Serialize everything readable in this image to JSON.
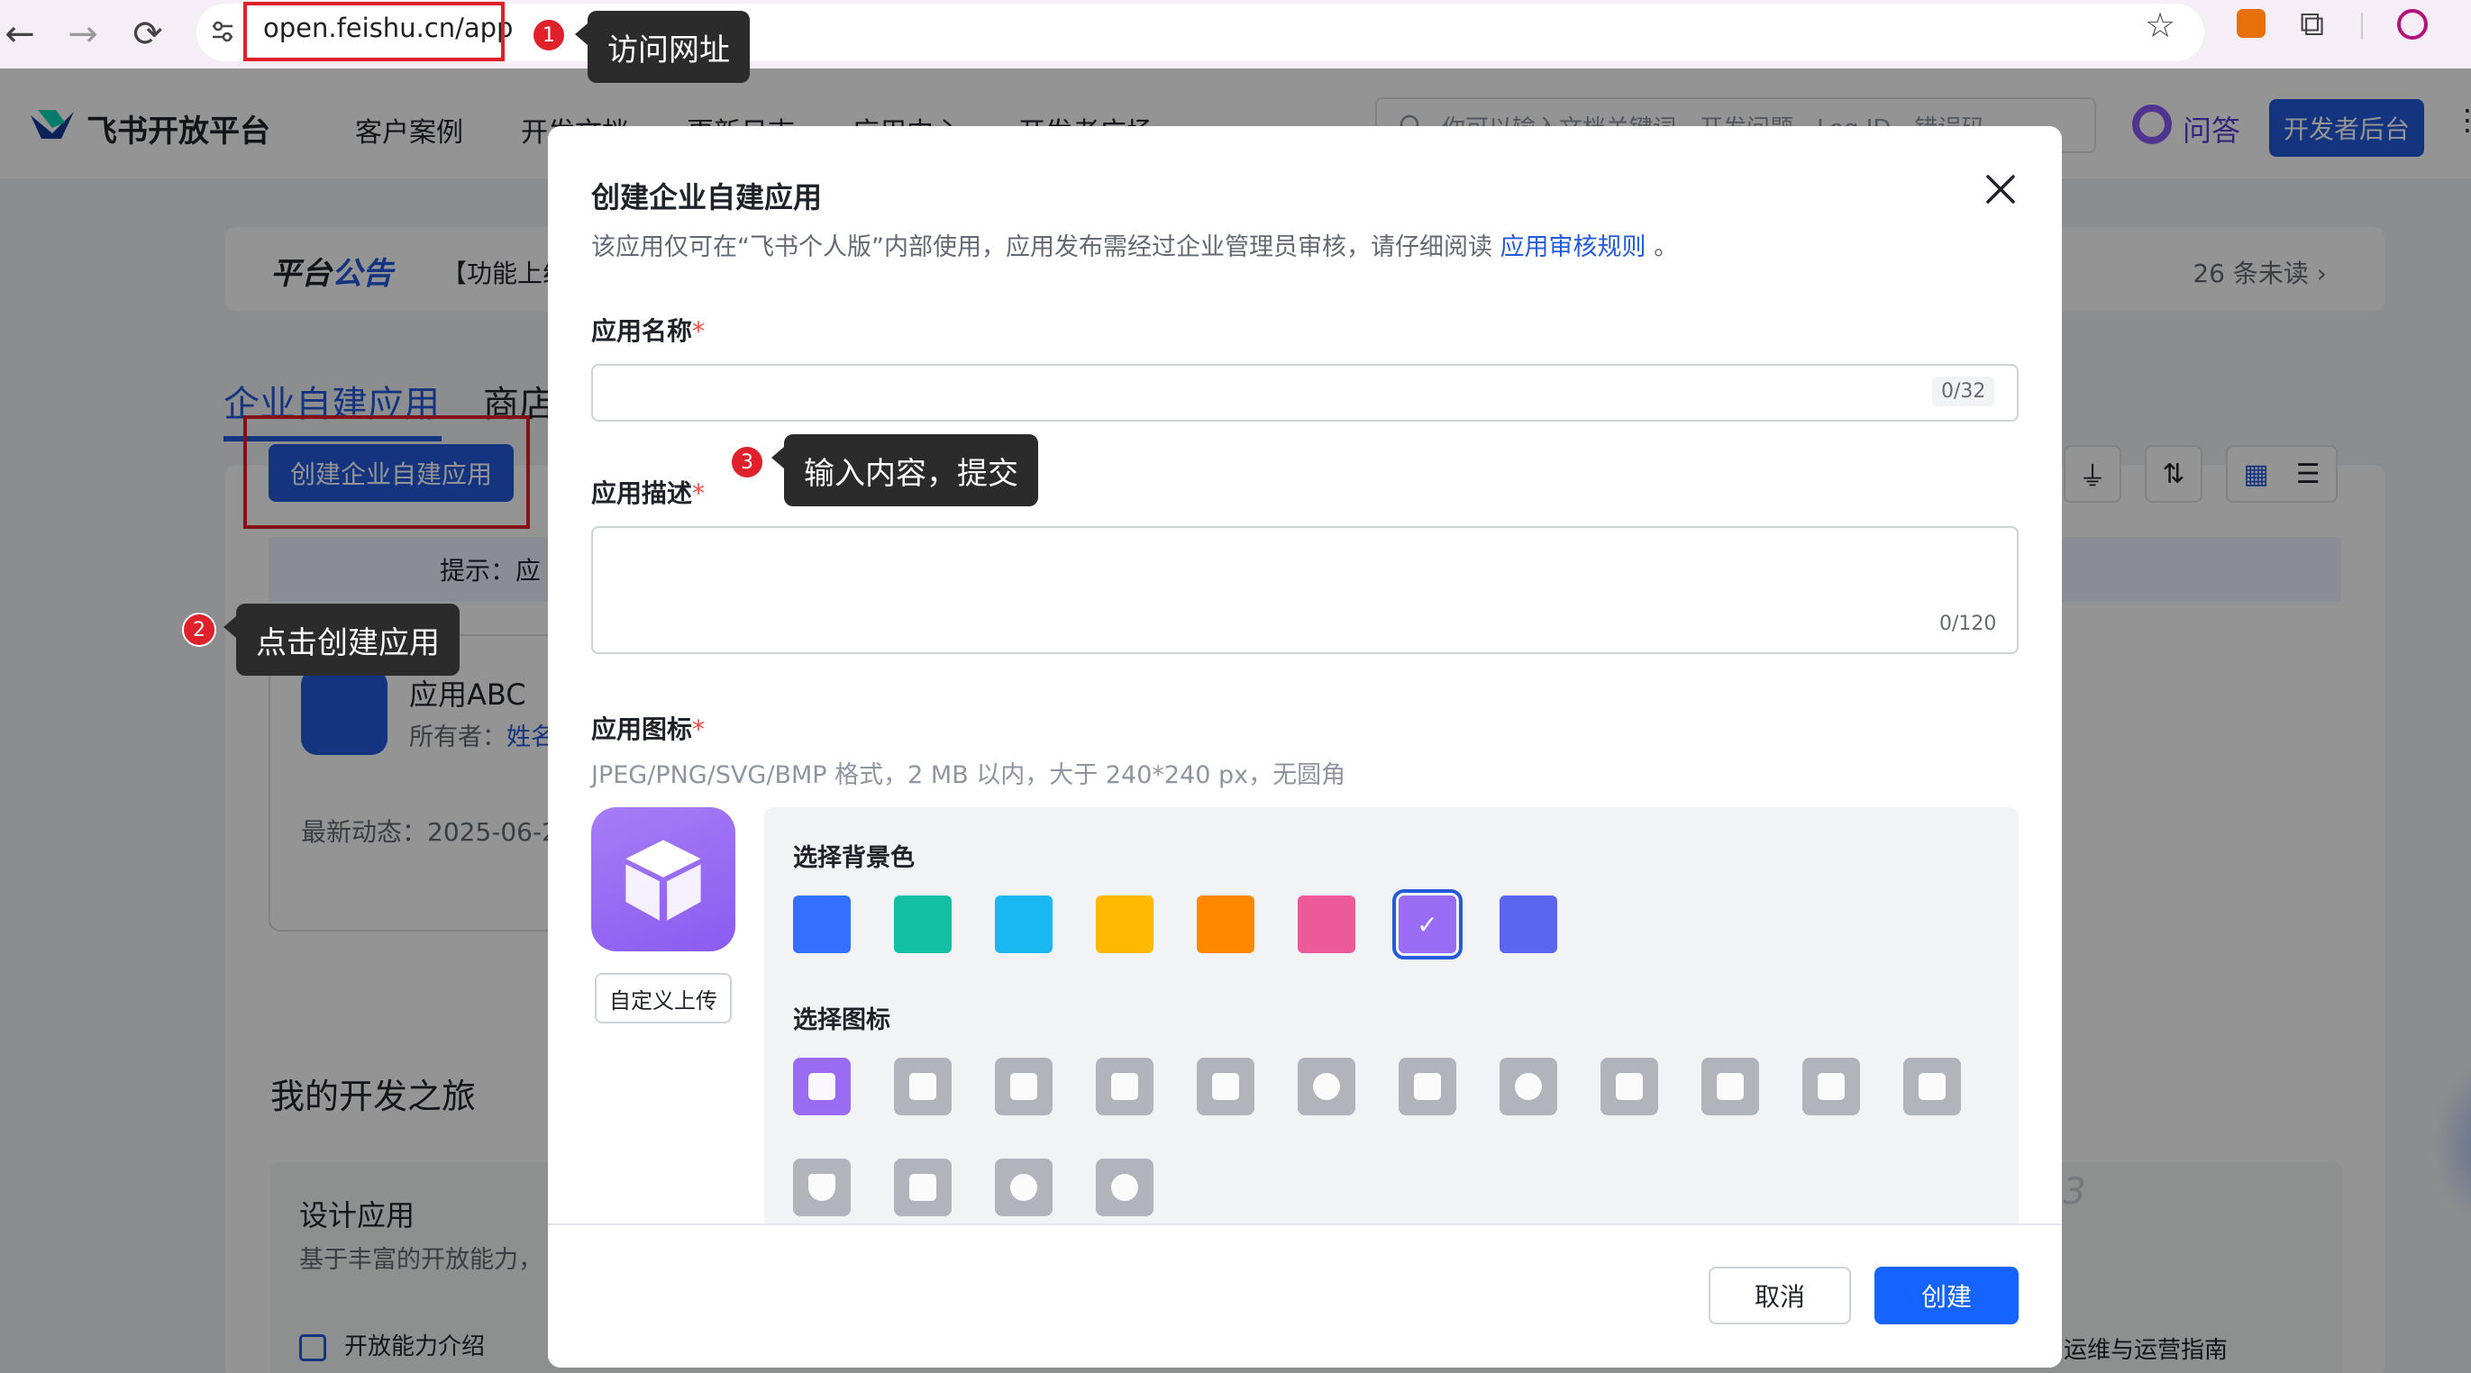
{
  "browser": {
    "url": "open.feishu.cn/app"
  },
  "header": {
    "logo_text": "飞书开放平台",
    "nav": [
      "客户案例",
      "开发文档",
      "更新日志",
      "应用中心",
      "开发者广场"
    ],
    "search_placeholder": "你可以输入文档关键词、开发问题、Log ID、错误码",
    "qa_label": "问答",
    "dev_console_label": "开发者后台"
  },
  "notice": {
    "title_a": "平台",
    "title_b": "公告",
    "body": "【功能上线",
    "unread": "26 条未读 ›"
  },
  "tabs": {
    "enterprise": "企业自建应用",
    "store": "商店"
  },
  "list": {
    "create_button": "创建企业自建应用",
    "hint": "提示：应",
    "app_name": "应用ABC",
    "owner_label": "所有者：",
    "owner_value": "姓名",
    "latest": "最新动态：2025-06-2"
  },
  "journey": {
    "title": "我的开发之旅",
    "design_title": "设计应用",
    "design_sub": "基于丰富的开放能力，",
    "link_capabilities": "开放能力介绍",
    "step_label": "step 3",
    "link_ops": "运维与运营指南"
  },
  "modal": {
    "title": "创建企业自建应用",
    "desc_prefix": "该应用仅可在“飞书个人版”内部使用，应用发布需经过企业管理员审核，请仔细阅读 ",
    "desc_link": "应用审核规则",
    "desc_suffix": " 。",
    "name_label": "应用名称",
    "name_value": "",
    "name_counter": "0/32",
    "desc_label": "应用描述",
    "desc_value": "",
    "desc_counter": "0/120",
    "icon_label": "应用图标",
    "icon_hint": "JPEG/PNG/SVG/BMP 格式，2 MB 以内，大于 240*240 px，无圆角",
    "upload_label": "自定义上传",
    "bg_label": "选择背景色",
    "glyph_label": "选择图标",
    "bg_colors": [
      "#3370ff",
      "#14c0a3",
      "#1ab8f2",
      "#ffba00",
      "#ff8800",
      "#ec5a9a",
      "#9a6cf4",
      "#5b65f0"
    ],
    "selected_bg_index": 6,
    "glyph_icons": [
      "cube-icon",
      "robot-icon",
      "lightbulb-icon",
      "document-icon",
      "briefcase-icon",
      "bell-icon",
      "badge-icon",
      "pie-chart-icon",
      "star-icon",
      "tag-icon",
      "wrench-icon",
      "file-icon",
      "shield-icon",
      "layout-icon",
      "users-icon",
      "code-icon"
    ],
    "cancel_label": "取消",
    "create_label": "创建"
  },
  "annotations": [
    {
      "number": "1",
      "text": "访问网址"
    },
    {
      "number": "2",
      "text": "点击创建应用"
    },
    {
      "number": "3",
      "text": "输入内容，提交"
    }
  ]
}
